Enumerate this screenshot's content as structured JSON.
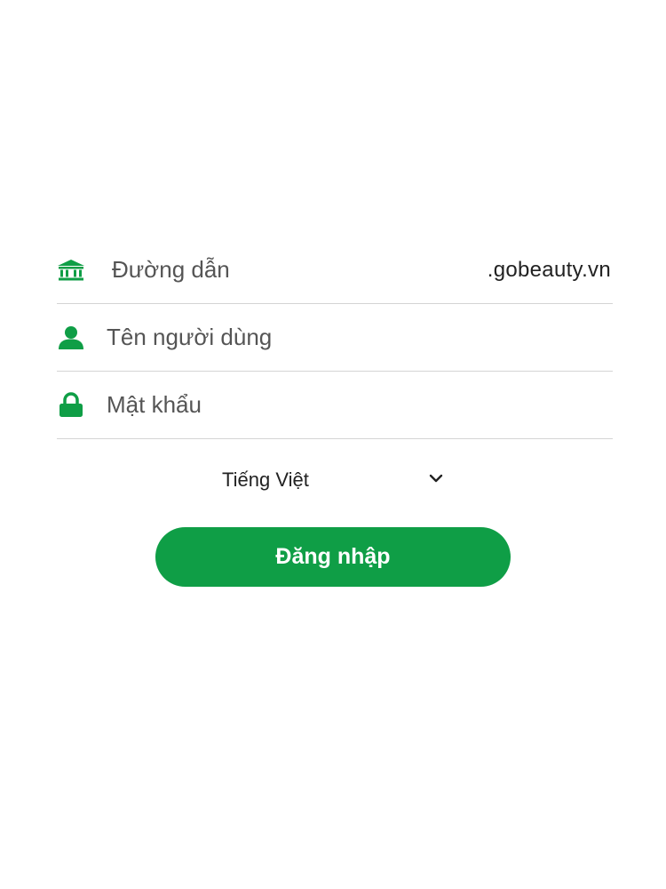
{
  "theme": {
    "accent": "#0f9e46",
    "divider": "#d4d4d4"
  },
  "form": {
    "url_field": {
      "icon": "bank-icon",
      "placeholder": "Đường dẫn",
      "suffix": ".gobeauty.vn"
    },
    "username_field": {
      "icon": "user-icon",
      "placeholder": "Tên người dùng"
    },
    "password_field": {
      "icon": "lock-icon",
      "placeholder": "Mật khẩu"
    }
  },
  "language": {
    "selected": "Tiếng Việt",
    "icon": "chevron-down-icon"
  },
  "login_button": {
    "label": "Đăng nhập"
  }
}
